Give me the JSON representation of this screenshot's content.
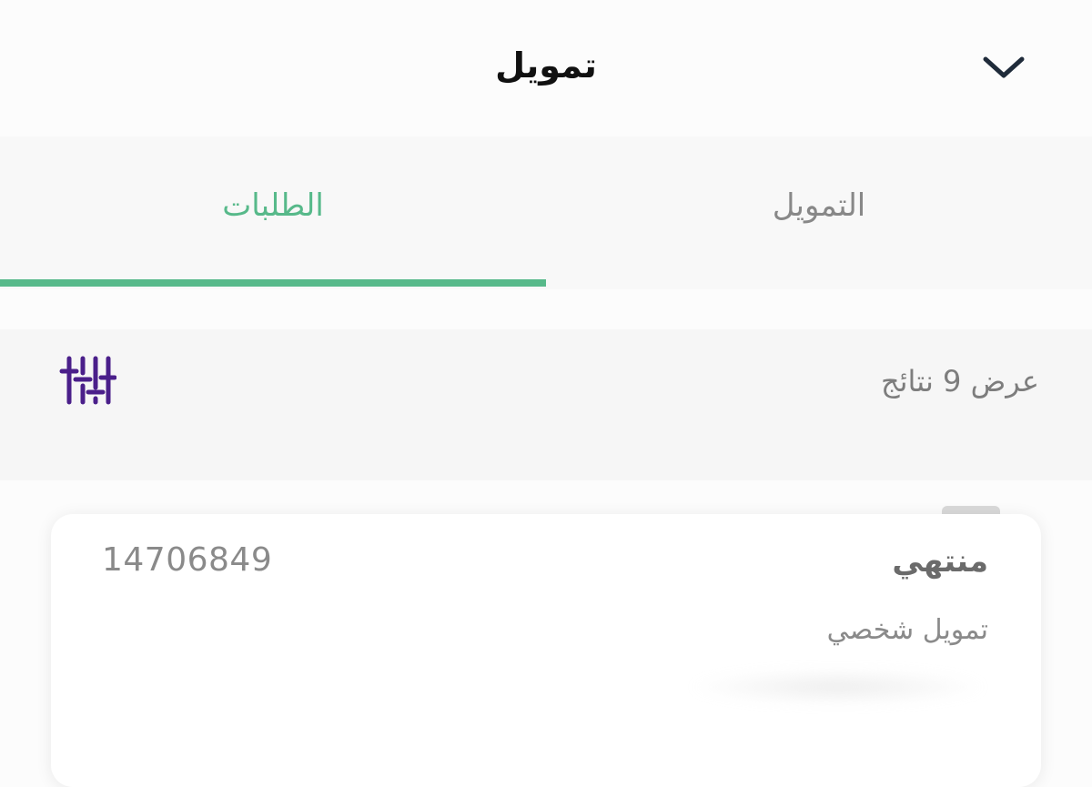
{
  "header": {
    "title": "تمويل",
    "collapse_icon": "chevron-down-icon"
  },
  "tabs": [
    {
      "label": "الطلبات",
      "active": true
    },
    {
      "label": "التمويل",
      "active": false
    }
  ],
  "results": {
    "text": "عرض 9 نتائج",
    "filter_icon": "sliders-icon"
  },
  "card": {
    "status": "منتهي",
    "number": "14706849",
    "type": "تمويل شخصي"
  },
  "colors": {
    "accent": "#57b98a",
    "filter_icon": "#4a1f8a"
  }
}
